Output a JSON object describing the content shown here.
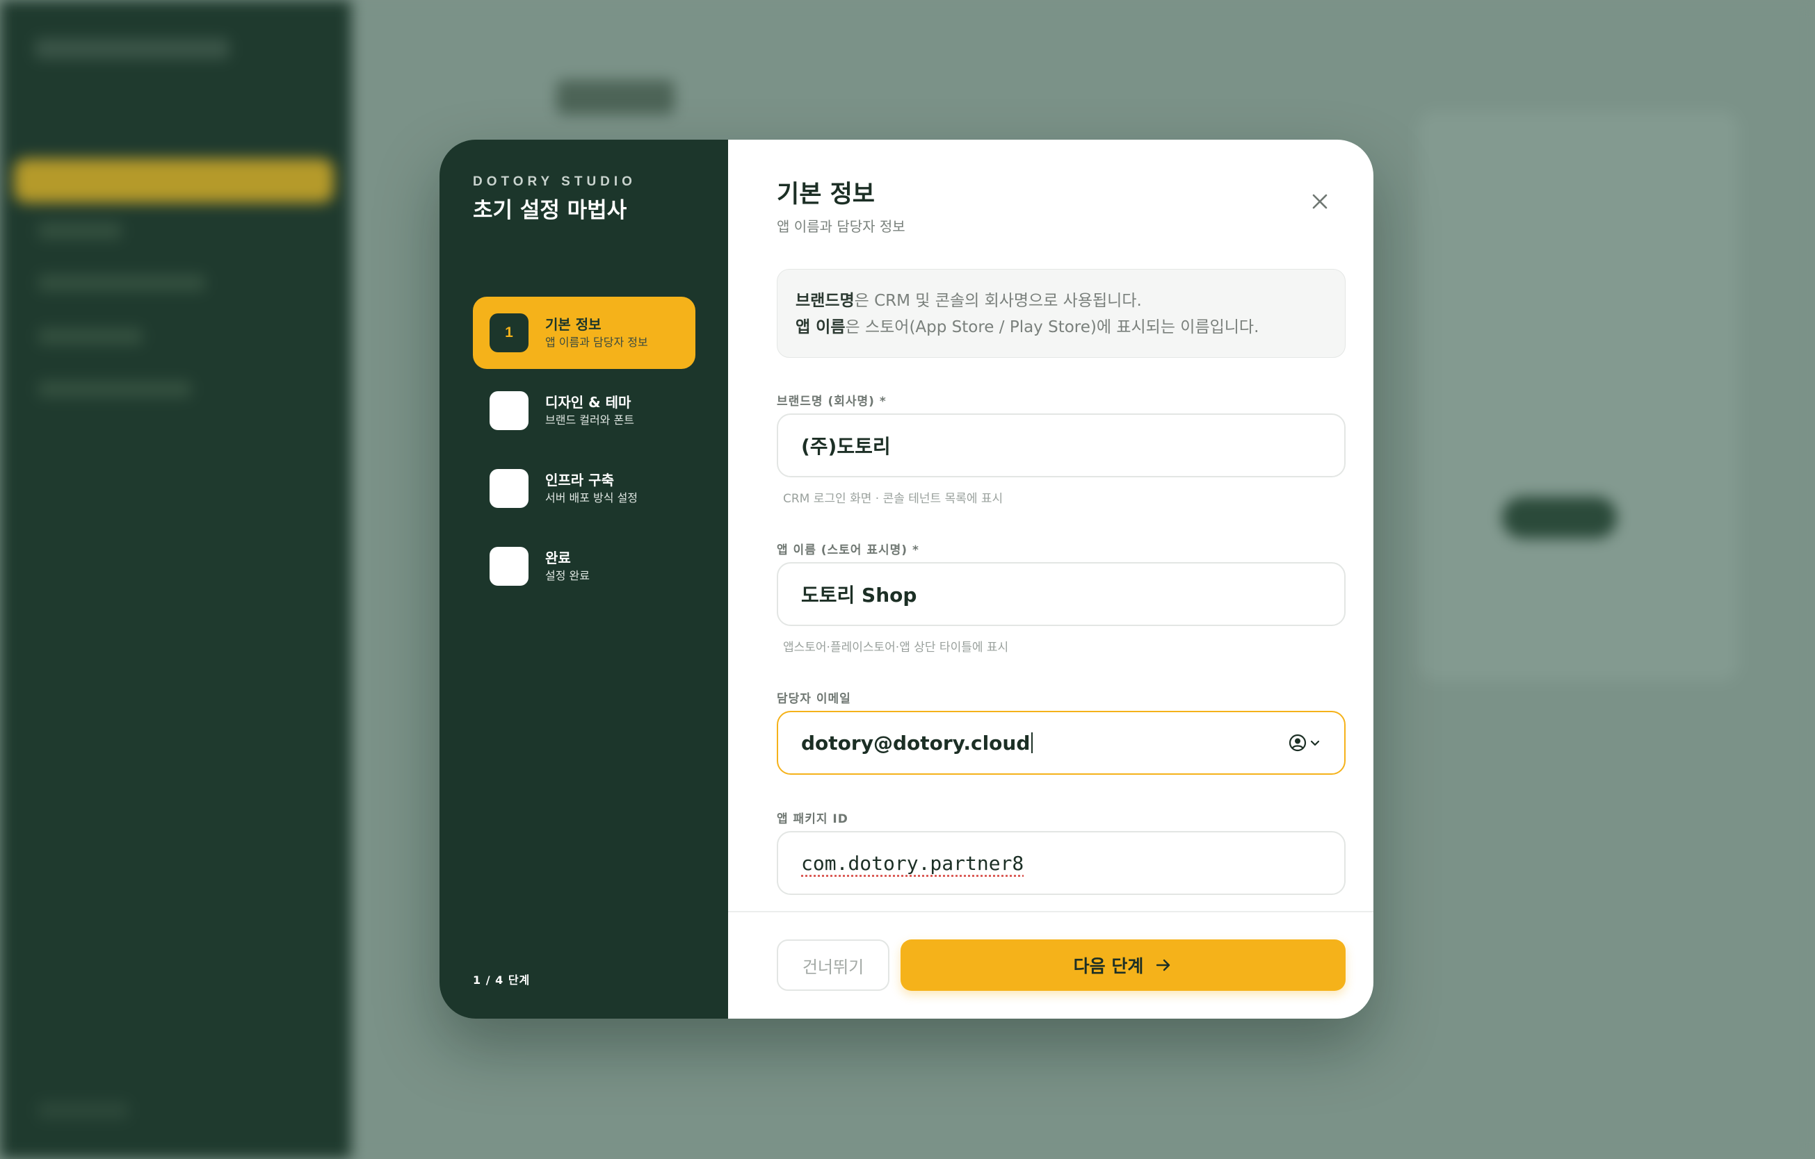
{
  "wizard": {
    "brand": "DOTORY STUDIO",
    "title": "초기 설정 마법사",
    "steps": [
      {
        "number": "1",
        "title": "기본 정보",
        "subtitle": "앱 이름과 담당자 정보",
        "active": true
      },
      {
        "number": "",
        "title": "디자인 & 테마",
        "subtitle": "브랜드 컬러와 폰트",
        "active": false
      },
      {
        "number": "",
        "title": "인프라 구축",
        "subtitle": "서버 배포 방식 설정",
        "active": false
      },
      {
        "number": "",
        "title": "완료",
        "subtitle": "설정 완료",
        "active": false
      }
    ],
    "progress": "1 / 4 단계"
  },
  "panel": {
    "title": "기본 정보",
    "subtitle": "앱 이름과 담당자 정보",
    "info": {
      "line1_bold": "브랜드명",
      "line1_rest": "은 CRM 및 콘솔의 회사명으로 사용됩니다.",
      "line2_bold": "앱 이름",
      "line2_rest": "은 스토어(App Store / Play Store)에 표시되는 이름입니다."
    },
    "fields": {
      "brand": {
        "label": "브랜드명 (회사명) *",
        "value": "(주)도토리",
        "hint": "CRM 로그인 화면 · 콘솔 테넌트 목록에 표시"
      },
      "app_name": {
        "label": "앱 이름 (스토어 표시명) *",
        "value": "도토리 Shop",
        "hint": "앱스토어·플레이스토어·앱 상단 타이틀에 표시"
      },
      "email": {
        "label": "담당자 이메일",
        "value": "dotory@dotory.cloud"
      },
      "package_id": {
        "label": "앱 패키지 ID",
        "value": "com.dotory.partner8"
      }
    },
    "buttons": {
      "skip": "건너뛰기",
      "next": "다음 단계"
    }
  },
  "colors": {
    "accent": "#f5b21a",
    "sidebar": "#1c362b"
  },
  "icons": [
    "close-icon",
    "autofill-icon",
    "arrow-right-icon"
  ]
}
